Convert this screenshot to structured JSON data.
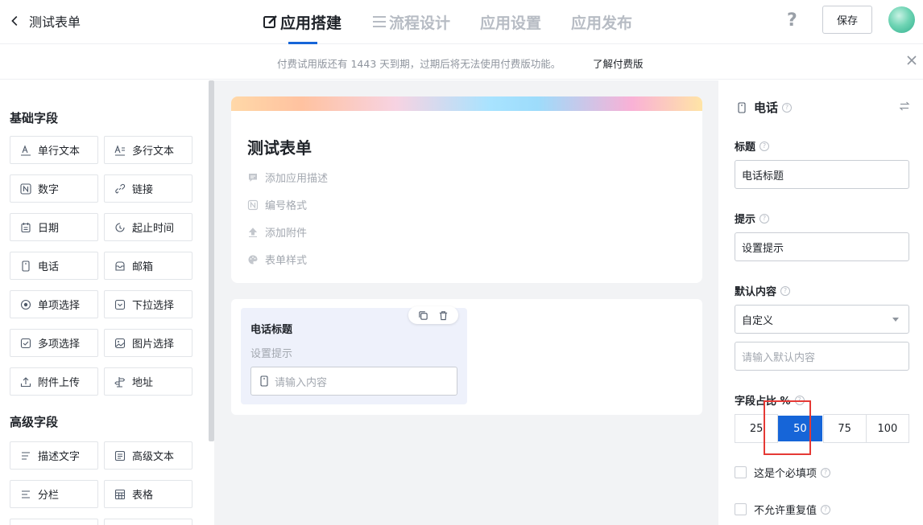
{
  "header": {
    "back_label": "测试表单",
    "tabs": [
      {
        "label": "应用搭建",
        "active": true
      },
      {
        "label": "流程设计",
        "active": false
      },
      {
        "label": "应用设置",
        "active": false
      },
      {
        "label": "应用发布",
        "active": false
      }
    ],
    "help": "?",
    "save_label": "保存"
  },
  "notice": {
    "text": "付费试用版还有 1443 天到期，过期后将无法使用付费版功能。",
    "link": "了解付费版"
  },
  "left_panel": {
    "basic_title": "基础字段",
    "basic_fields": [
      {
        "label": "单行文本",
        "icon": "single-line-text-icon"
      },
      {
        "label": "多行文本",
        "icon": "multi-line-text-icon"
      },
      {
        "label": "数字",
        "icon": "number-icon"
      },
      {
        "label": "链接",
        "icon": "link-icon"
      },
      {
        "label": "日期",
        "icon": "calendar-icon"
      },
      {
        "label": "起止时间",
        "icon": "time-range-icon"
      },
      {
        "label": "电话",
        "icon": "phone-icon"
      },
      {
        "label": "邮箱",
        "icon": "mail-icon"
      },
      {
        "label": "单项选择",
        "icon": "radio-icon"
      },
      {
        "label": "下拉选择",
        "icon": "dropdown-icon"
      },
      {
        "label": "多项选择",
        "icon": "checkbox-icon"
      },
      {
        "label": "图片选择",
        "icon": "image-icon"
      },
      {
        "label": "附件上传",
        "icon": "upload-icon"
      },
      {
        "label": "地址",
        "icon": "address-icon"
      }
    ],
    "advanced_title": "高级字段",
    "advanced_fields": [
      {
        "label": "描述文字",
        "icon": "description-icon"
      },
      {
        "label": "高级文本",
        "icon": "rich-text-icon"
      },
      {
        "label": "分栏",
        "icon": "columns-icon"
      },
      {
        "label": "表格",
        "icon": "table-icon"
      }
    ]
  },
  "form": {
    "title": "测试表单",
    "actions": [
      {
        "label": "添加应用描述",
        "icon": "comment-icon"
      },
      {
        "label": "编号格式",
        "icon": "number-format-icon"
      },
      {
        "label": "添加附件",
        "icon": "upload-icon"
      },
      {
        "label": "表单样式",
        "icon": "palette-icon"
      }
    ],
    "field": {
      "title": "电话标题",
      "hint": "设置提示",
      "placeholder": "请输入内容"
    }
  },
  "right_panel": {
    "title": "电话",
    "title_label": "标题",
    "title_value": "电话标题",
    "hint_label": "提示",
    "hint_value": "设置提示",
    "default_label": "默认内容",
    "default_select": "自定义",
    "default_placeholder": "请输入默认内容",
    "width_label": "字段占比 %",
    "width_options": [
      "25",
      "50",
      "75",
      "100"
    ],
    "width_selected": "50",
    "required_label": "这是个必填项",
    "no_duplicate_label": "不允许重复值",
    "accent_color": "#1665d8",
    "highlight_color": "#e53935"
  }
}
